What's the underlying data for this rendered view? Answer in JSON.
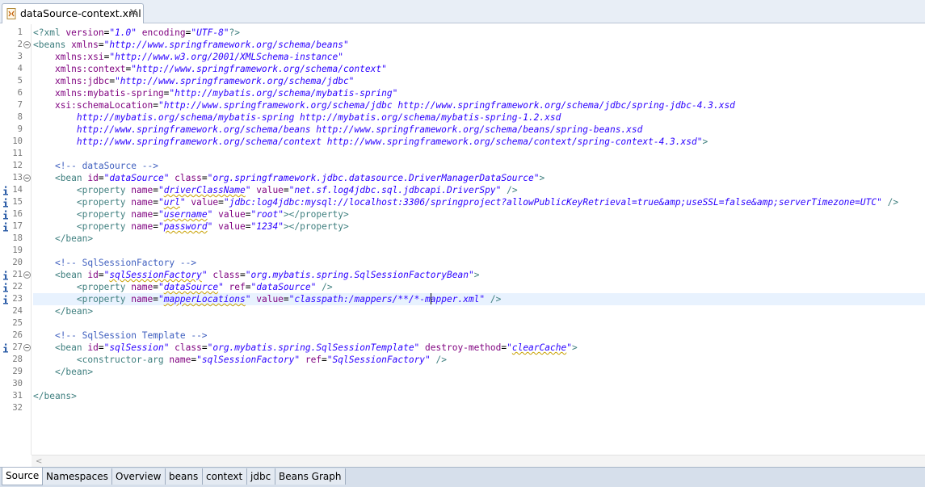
{
  "editor_tab": {
    "title": "dataSource-context.xml",
    "icon": "xml-file-icon",
    "close_icon": "close-icon"
  },
  "current_line": 23,
  "lines": [
    {
      "n": 1,
      "t": [
        [
          "pi",
          "<?xml "
        ],
        [
          "at",
          "version"
        ],
        [
          "",
          "="
        ],
        [
          "av",
          "\"1.0\""
        ],
        [
          "at",
          " encoding"
        ],
        [
          "",
          "="
        ],
        [
          "av",
          "\"UTF-8\""
        ],
        [
          "pi",
          "?>"
        ]
      ]
    },
    {
      "n": 2,
      "fold": true,
      "t": [
        [
          "tg",
          "<beans "
        ],
        [
          "at",
          "xmlns"
        ],
        [
          "",
          "="
        ],
        [
          "av",
          "\"http://www.springframework.org/schema/beans\""
        ]
      ]
    },
    {
      "n": 3,
      "t": [
        [
          "",
          "    "
        ],
        [
          "at",
          "xmlns:xsi"
        ],
        [
          "",
          "="
        ],
        [
          "av",
          "\"http://www.w3.org/2001/XMLSchema-instance\""
        ]
      ]
    },
    {
      "n": 4,
      "t": [
        [
          "",
          "    "
        ],
        [
          "at",
          "xmlns:context"
        ],
        [
          "",
          "="
        ],
        [
          "av",
          "\"http://www.springframework.org/schema/context\""
        ]
      ]
    },
    {
      "n": 5,
      "t": [
        [
          "",
          "    "
        ],
        [
          "at",
          "xmlns:jdbc"
        ],
        [
          "",
          "="
        ],
        [
          "av",
          "\"http://www.springframework.org/schema/jdbc\""
        ]
      ]
    },
    {
      "n": 6,
      "t": [
        [
          "",
          "    "
        ],
        [
          "at",
          "xmlns:mybatis-spring"
        ],
        [
          "",
          "="
        ],
        [
          "av",
          "\"http://mybatis.org/schema/mybatis-spring\""
        ]
      ]
    },
    {
      "n": 7,
      "t": [
        [
          "",
          "    "
        ],
        [
          "at",
          "xsi:schemaLocation"
        ],
        [
          "",
          "="
        ],
        [
          "av",
          "\"http://www.springframework.org/schema/jdbc http://www.springframework.org/schema/jdbc/spring-jdbc-4.3.xsd"
        ]
      ]
    },
    {
      "n": 8,
      "t": [
        [
          "",
          "        "
        ],
        [
          "av",
          "http://mybatis.org/schema/mybatis-spring http://mybatis.org/schema/mybatis-spring-1.2.xsd"
        ]
      ]
    },
    {
      "n": 9,
      "t": [
        [
          "",
          "        "
        ],
        [
          "av",
          "http://www.springframework.org/schema/beans http://www.springframework.org/schema/beans/spring-beans.xsd"
        ]
      ]
    },
    {
      "n": 10,
      "t": [
        [
          "",
          "        "
        ],
        [
          "av",
          "http://www.springframework.org/schema/context http://www.springframework.org/schema/context/spring-context-4.3.xsd\""
        ],
        [
          "tg",
          ">"
        ]
      ]
    },
    {
      "n": 11,
      "t": []
    },
    {
      "n": 12,
      "t": [
        [
          "",
          "    "
        ],
        [
          "cm",
          "<!-- dataSource -->"
        ]
      ]
    },
    {
      "n": 13,
      "fold": true,
      "t": [
        [
          "",
          "    "
        ],
        [
          "tg",
          "<bean "
        ],
        [
          "at",
          "id"
        ],
        [
          "",
          "="
        ],
        [
          "av",
          "\"dataSource\""
        ],
        [
          "at",
          " class"
        ],
        [
          "",
          "="
        ],
        [
          "av",
          "\"org.springframework.jdbc.datasource.DriverManagerDataSource\""
        ],
        [
          "tg",
          ">"
        ]
      ]
    },
    {
      "n": 14,
      "info": true,
      "t": [
        [
          "",
          "        "
        ],
        [
          "tg",
          "<property "
        ],
        [
          "at",
          "name"
        ],
        [
          "",
          "="
        ],
        [
          "av",
          "\""
        ],
        [
          "av sq",
          "driverClassName"
        ],
        [
          "av",
          "\""
        ],
        [
          "at",
          " value"
        ],
        [
          "",
          "="
        ],
        [
          "av",
          "\"net.sf.log4jdbc.sql.jdbcapi.DriverSpy\""
        ],
        [
          "tg",
          " />"
        ]
      ]
    },
    {
      "n": 15,
      "info": true,
      "t": [
        [
          "",
          "        "
        ],
        [
          "tg",
          "<property "
        ],
        [
          "at",
          "name"
        ],
        [
          "",
          "="
        ],
        [
          "av",
          "\""
        ],
        [
          "av sq",
          "url"
        ],
        [
          "av",
          "\""
        ],
        [
          "at",
          " value"
        ],
        [
          "",
          "="
        ],
        [
          "av",
          "\"jdbc:log4jdbc:mysql://localhost:3306/springproject?allowPublicKeyRetrieval=true&amp;useSSL=false&amp;serverTimezone=UTC\""
        ],
        [
          "tg",
          " />"
        ]
      ]
    },
    {
      "n": 16,
      "info": true,
      "t": [
        [
          "",
          "        "
        ],
        [
          "tg",
          "<property "
        ],
        [
          "at",
          "name"
        ],
        [
          "",
          "="
        ],
        [
          "av",
          "\""
        ],
        [
          "av sq",
          "username"
        ],
        [
          "av",
          "\""
        ],
        [
          "at",
          " value"
        ],
        [
          "",
          "="
        ],
        [
          "av",
          "\"root\""
        ],
        [
          "tg",
          "></property>"
        ]
      ]
    },
    {
      "n": 17,
      "info": true,
      "t": [
        [
          "",
          "        "
        ],
        [
          "tg",
          "<property "
        ],
        [
          "at",
          "name"
        ],
        [
          "",
          "="
        ],
        [
          "av",
          "\""
        ],
        [
          "av sq",
          "password"
        ],
        [
          "av",
          "\""
        ],
        [
          "at",
          " value"
        ],
        [
          "",
          "="
        ],
        [
          "av",
          "\"1234\""
        ],
        [
          "tg",
          "></property>"
        ]
      ]
    },
    {
      "n": 18,
      "t": [
        [
          "",
          "    "
        ],
        [
          "tg",
          "</bean>"
        ]
      ]
    },
    {
      "n": 19,
      "t": []
    },
    {
      "n": 20,
      "t": [
        [
          "",
          "    "
        ],
        [
          "cm",
          "<!-- SqlSessionFactory -->"
        ]
      ]
    },
    {
      "n": 21,
      "fold": true,
      "info": true,
      "t": [
        [
          "",
          "    "
        ],
        [
          "tg",
          "<bean "
        ],
        [
          "at",
          "id"
        ],
        [
          "",
          "="
        ],
        [
          "av",
          "\""
        ],
        [
          "av sq",
          "sqlSessionFactory"
        ],
        [
          "av",
          "\""
        ],
        [
          "at",
          " class"
        ],
        [
          "",
          "="
        ],
        [
          "av",
          "\"org.mybatis.spring.SqlSessionFactoryBean\""
        ],
        [
          "tg",
          ">"
        ]
      ]
    },
    {
      "n": 22,
      "info": true,
      "t": [
        [
          "",
          "        "
        ],
        [
          "tg",
          "<property "
        ],
        [
          "at",
          "name"
        ],
        [
          "",
          "="
        ],
        [
          "av",
          "\""
        ],
        [
          "av sq",
          "dataSource"
        ],
        [
          "av",
          "\""
        ],
        [
          "at",
          " ref"
        ],
        [
          "",
          "="
        ],
        [
          "av",
          "\"dataSource\""
        ],
        [
          "tg",
          " />"
        ]
      ]
    },
    {
      "n": 23,
      "info": true,
      "t": [
        [
          "",
          "        "
        ],
        [
          "tg",
          "<property "
        ],
        [
          "at",
          "name"
        ],
        [
          "",
          "="
        ],
        [
          "av",
          "\""
        ],
        [
          "av sq",
          "mapperLocations"
        ],
        [
          "av",
          "\""
        ],
        [
          "at",
          " value"
        ],
        [
          "",
          "="
        ],
        [
          "av",
          "\"classpath:/mappers/**/*-mapper.xml\""
        ],
        [
          "tg",
          " />"
        ]
      ]
    },
    {
      "n": 24,
      "t": [
        [
          "",
          "    "
        ],
        [
          "tg",
          "</bean>"
        ]
      ]
    },
    {
      "n": 25,
      "t": []
    },
    {
      "n": 26,
      "t": [
        [
          "",
          "    "
        ],
        [
          "cm",
          "<!-- SqlSession Template -->"
        ]
      ]
    },
    {
      "n": 27,
      "fold": true,
      "info": true,
      "t": [
        [
          "",
          "    "
        ],
        [
          "tg",
          "<bean "
        ],
        [
          "at",
          "id"
        ],
        [
          "",
          "="
        ],
        [
          "av",
          "\"sqlSession\""
        ],
        [
          "at",
          " class"
        ],
        [
          "",
          "="
        ],
        [
          "av",
          "\"org.mybatis.spring.SqlSessionTemplate\""
        ],
        [
          "at",
          " destroy-method"
        ],
        [
          "",
          "="
        ],
        [
          "av",
          "\""
        ],
        [
          "av sq",
          "clearCache"
        ],
        [
          "av",
          "\""
        ],
        [
          "tg",
          ">"
        ]
      ]
    },
    {
      "n": 28,
      "t": [
        [
          "",
          "        "
        ],
        [
          "tg",
          "<constructor-arg "
        ],
        [
          "at",
          "name"
        ],
        [
          "",
          "="
        ],
        [
          "av",
          "\"sqlSessionFactory\""
        ],
        [
          "at",
          " ref"
        ],
        [
          "",
          "="
        ],
        [
          "av",
          "\"SqlSessionFactory\""
        ],
        [
          "tg",
          " />"
        ]
      ]
    },
    {
      "n": 29,
      "t": [
        [
          "",
          "    "
        ],
        [
          "tg",
          "</bean>"
        ]
      ]
    },
    {
      "n": 30,
      "t": []
    },
    {
      "n": 31,
      "t": [
        [
          "tg",
          "</beans>"
        ]
      ]
    },
    {
      "n": 32,
      "t": []
    }
  ],
  "bottom_tabs": [
    {
      "label": "Source",
      "active": true
    },
    {
      "label": "Namespaces"
    },
    {
      "label": "Overview"
    },
    {
      "label": "beans"
    },
    {
      "label": "context"
    },
    {
      "label": "jdbc"
    },
    {
      "label": "Beans Graph"
    }
  ],
  "colors": {
    "tag": "#3f7f7f",
    "attribute": "#7f007f",
    "value": "#2a00ff",
    "comment": "#3f5fbf",
    "current_line": "#e8f2fe"
  }
}
